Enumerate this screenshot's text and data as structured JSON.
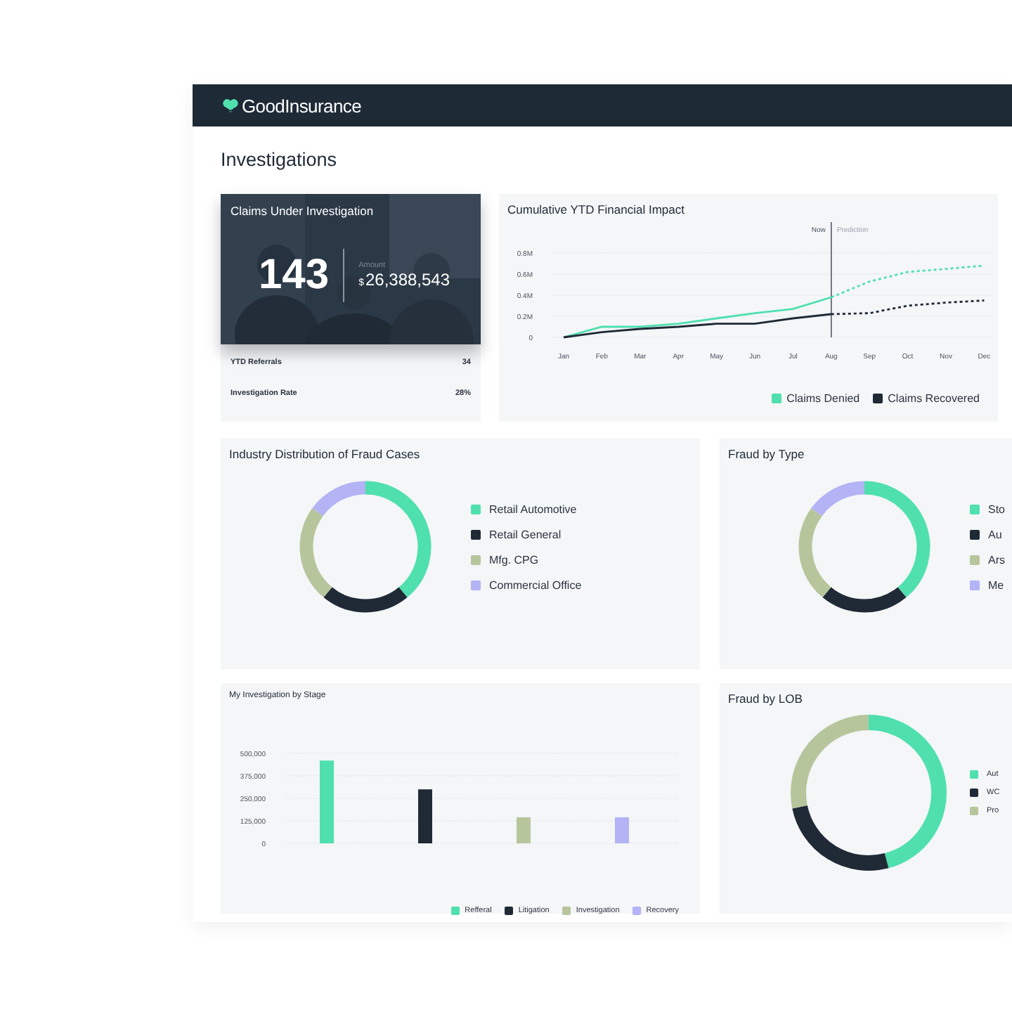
{
  "header": {
    "logo": "Good**Insurance**"
  },
  "page_title": "Investigations",
  "summary": {
    "title": "Claims Under Investigation",
    "count": "143",
    "amount_label": "Amount",
    "currency": "$",
    "amount": "26,388,543",
    "stats": [
      {
        "label": "YTD Referrals",
        "value": "34"
      },
      {
        "label": "Investigation Rate",
        "value": "28%"
      }
    ]
  },
  "impact": {
    "title": "Cumulative YTD Financial Impact",
    "chart_data": {
      "type": "line",
      "categories": [
        "Jan",
        "Feb",
        "Mar",
        "Apr",
        "May",
        "Jun",
        "Jul",
        "Aug",
        "Sep",
        "Oct",
        "Nov",
        "Dec"
      ],
      "yticks": [
        {
          "value": 0,
          "label": "0"
        },
        {
          "value": 0.2,
          "label": "0.2M"
        },
        {
          "value": 0.4,
          "label": "0.4M"
        },
        {
          "value": 0.6,
          "label": "0.6M"
        },
        {
          "value": 0.8,
          "label": "0.8M"
        }
      ],
      "ylim": [
        0,
        0.8
      ],
      "grid": true,
      "series": [
        {
          "name": "Claims Denied",
          "color": "#4fe0ae",
          "line_style": "solid",
          "values": [
            0,
            0.1,
            0.1,
            0.13,
            0.18,
            0.23,
            0.27,
            0.38,
            null,
            null,
            null,
            null
          ]
        },
        {
          "name": "Claims Recovered",
          "color": "#1f2a36",
          "line_style": "solid",
          "values": [
            0,
            0.05,
            0.08,
            0.1,
            0.13,
            0.13,
            0.18,
            0.22,
            null,
            null,
            null,
            null
          ]
        },
        {
          "color": "#4fe0ae",
          "line_style": "dotted",
          "values": [
            null,
            null,
            null,
            null,
            null,
            null,
            null,
            0.38,
            0.53,
            0.62,
            0.65,
            0.68
          ]
        },
        {
          "color": "#1f2a36",
          "line_style": "dotted",
          "values": [
            null,
            null,
            null,
            null,
            null,
            null,
            null,
            0.22,
            0.23,
            0.3,
            0.33,
            0.35
          ]
        }
      ],
      "ref_lines": [
        {
          "axis": "x",
          "value": "Aug"
        }
      ],
      "annotations": [
        "Now",
        "Prediction"
      ]
    }
  },
  "donuts": [
    {
      "title": "Industry Distribution of Fraud Cases",
      "legend": [
        {
          "label": "Retail Automotive",
          "color": "#4fe0ae"
        },
        {
          "label": "Retail General",
          "color": "#1f2a36"
        },
        {
          "label": "Mfg. CPG",
          "color": "#b7c59c"
        },
        {
          "label": "Commercial Office",
          "color": "#b3b3f5"
        }
      ]
    },
    {
      "title": "Fraud by Type",
      "legend": [
        {
          "label": "Sto",
          "color": "#4fe0ae"
        },
        {
          "label": "Au",
          "color": "#1f2a36"
        },
        {
          "label": "Ars",
          "color": "#b7c59c"
        },
        {
          "label": "Me",
          "color": "#b3b3f5"
        }
      ]
    },
    {
      "title": "Fraud by LOB",
      "legend": [
        {
          "label": "Aut",
          "color": "#4fe0ae"
        },
        {
          "label": "WC",
          "color": "#1f2a36"
        },
        {
          "label": "Pro",
          "color": "#b7c59c"
        }
      ]
    }
  ],
  "stage": {
    "title": "My Investigation by Stage",
    "chart_data": {
      "type": "bar",
      "ylim": [
        0,
        500000
      ],
      "grid": true,
      "yticks": [
        {
          "value": 0,
          "label": "0"
        },
        {
          "value": 125000,
          "label": "125,000"
        },
        {
          "value": 250000,
          "label": "250,000"
        },
        {
          "value": 375000,
          "label": "375,000"
        },
        {
          "value": 500000,
          "label": "500,000"
        }
      ],
      "series": [
        {
          "name": "Refferal",
          "color": "#4fe0ae",
          "values": [
            460000
          ]
        },
        {
          "name": "Litigation",
          "color": "#1f2a36",
          "values": [
            300000
          ]
        },
        {
          "name": "Investigation",
          "color": "#b7c59c",
          "values": [
            145000
          ]
        },
        {
          "name": "Recovery",
          "color": "#b3b3f5",
          "values": [
            145000
          ]
        }
      ]
    }
  }
}
